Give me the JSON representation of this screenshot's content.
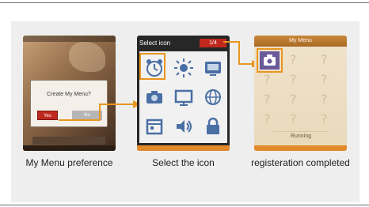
{
  "captions": {
    "step1": "My Menu preference",
    "step2": "Select the icon",
    "step3": "registeration completed"
  },
  "phone1": {
    "dialog_text": "Create My Menu?",
    "yes_label": "Yes",
    "no_label": "No"
  },
  "phone2": {
    "header_title": "Select icon",
    "counter": "1/4",
    "icons": [
      "alarm-clock-icon",
      "sun-icon",
      "screen-icon",
      "camera-icon",
      "monitor-icon",
      "globe-icon",
      "calendar-icon",
      "sound-icon",
      "lock-icon"
    ]
  },
  "phone3": {
    "title": "My Menu",
    "status": "Running"
  },
  "colors": {
    "highlight": "#e8961f",
    "accent_red": "#c0281e"
  }
}
